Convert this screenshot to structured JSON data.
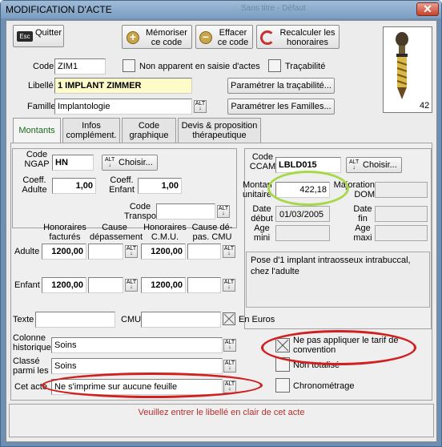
{
  "window": {
    "title": "MODIFICATION D'ACTE",
    "ghost_text": "Sans titre - Défaut",
    "close_glyph": "✕"
  },
  "toolbar": {
    "quit_icon_text": "Esc",
    "quit": "Quitter",
    "memorize": "Mémoriser ce code",
    "delete": "Effacer ce code",
    "recalc": "Recalculer les honoraires"
  },
  "header": {
    "code_label": "Code",
    "code_value": "ZIM1",
    "not_visible_label": "Non apparent en saisie d'actes",
    "traceability_label": "Traçabilité",
    "libelle_label": "Libellé",
    "libelle_value": "1 IMPLANT ZIMMER",
    "param_trace": "Paramétrer la traçabilité...",
    "famille_label": "Famille",
    "famille_value": "Implantologie",
    "param_familles": "Paramétrer les Familles...",
    "tooth_number": "42"
  },
  "tabs": [
    "Montants",
    "Infos complément.",
    "Code graphique",
    "Devis & proposition thérapeutique"
  ],
  "left": {
    "ngap_label": "Code NGAP",
    "ngap_value": "HN",
    "choose": "Choisir...",
    "coeff_adulte_label": "Coeff. Adulte",
    "coeff_adulte": "1,00",
    "coeff_enfant_label": "Coeff. Enfant",
    "coeff_enfant": "1,00",
    "code_transpo_label": "Code Transpo",
    "hdr_hon_fact": "Honoraires facturés",
    "hdr_cause_dep": "Cause dépassement",
    "hdr_hon_cmu": "Honoraires C.M.U.",
    "hdr_cause_cmu": "Cause dé-pas. CMU",
    "adulte_label": "Adulte",
    "adulte_hon": "1200,00",
    "adulte_cmu": "1200,00",
    "enfant_label": "Enfant",
    "enfant_hon": "1200,00",
    "enfant_cmu": "1200,00"
  },
  "ccam": {
    "code_label": "Code CCAM",
    "code_value": "LBLD015",
    "choose": "Choisir...",
    "montant_label": "Montant unitaire",
    "montant_value": "422,18",
    "majoration_label": "Majoration DOM",
    "date_debut_label": "Date début",
    "date_debut_value": "01/03/2005",
    "date_fin_label": "Date fin",
    "age_mini_label": "Age mini",
    "age_maxi_label": "Age maxi",
    "description": "Pose d'1 implant intraosseux intrabuccal, chez l'adulte"
  },
  "bottom": {
    "texte_label": "Texte",
    "cmu_label": "CMU",
    "en_euros_label": "En Euros",
    "colonne_label": "Colonne historique",
    "colonne_value": "Soins",
    "classe_label": "Classé parmi les",
    "classe_value": "Soins",
    "cet_acte_label": "Cet acte",
    "cet_acte_value": "Ne s'imprime sur aucune feuille",
    "ne_pas_appliquer": "Ne pas appliquer le tarif de convention",
    "non_totalise": "Non totalisé",
    "chrono": "Chronométrage",
    "status": "Veuillez entrer le libellé en clair de cet acte"
  },
  "alt_icon_text": "ALT\n↓",
  "colors": {
    "libelle_bg": "#fdfbc8",
    "green_ellipse": "#a8d84a",
    "red_ellipse": "#d02020",
    "status_text": "#b03030",
    "tab_active_text": "#1a6a1a"
  }
}
